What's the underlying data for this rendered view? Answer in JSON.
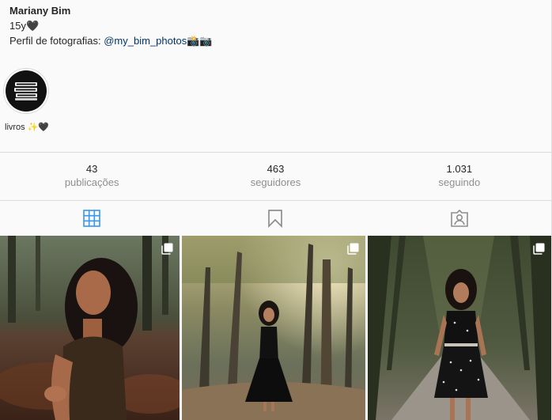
{
  "profile": {
    "name": "Mariany Bim",
    "bio_line1": "15y🖤",
    "bio_prefix": "Perfil de fotografias: ",
    "bio_link": "@my_bim_photos",
    "bio_suffix": "📸📷"
  },
  "highlights": [
    {
      "label": "livros ✨🖤",
      "icon": "books-icon"
    }
  ],
  "stats": [
    {
      "value": "43",
      "label": "publicações"
    },
    {
      "value": "463",
      "label": "seguidores"
    },
    {
      "value": "1.031",
      "label": "seguindo"
    }
  ],
  "tabs": [
    {
      "icon": "grid-icon",
      "active": true,
      "color": "#3897f0"
    },
    {
      "icon": "bookmark-icon",
      "active": false,
      "color": "#8e8e8e"
    },
    {
      "icon": "tagged-icon",
      "active": false,
      "color": "#8e8e8e"
    }
  ],
  "posts": [
    {
      "type": "carousel",
      "alt_icon": "multiple-photos-icon"
    },
    {
      "type": "carousel",
      "alt_icon": "multiple-photos-icon"
    },
    {
      "type": "carousel",
      "alt_icon": "multiple-photos-icon"
    }
  ]
}
